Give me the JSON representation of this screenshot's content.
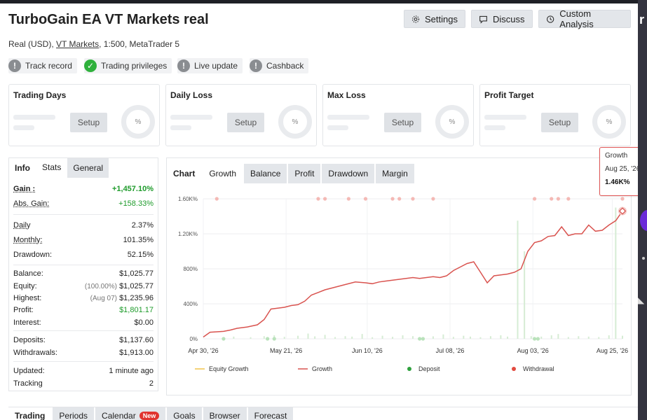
{
  "header": {
    "title": "TurboGain EA VT Markets real",
    "buttons": {
      "settings": "Settings",
      "discuss": "Discuss",
      "custom": "Custom Analysis"
    },
    "subtitle_prefix": "Real (USD), ",
    "subtitle_link": "VT Markets",
    "subtitle_suffix": ", 1:500, MetaTrader 5"
  },
  "badges": [
    {
      "label": "Track record",
      "state": "grey"
    },
    {
      "label": "Trading privileges",
      "state": "green"
    },
    {
      "label": "Live update",
      "state": "grey"
    },
    {
      "label": "Cashback",
      "state": "grey"
    }
  ],
  "kpis": [
    {
      "title": "Trading Days",
      "button": "Setup",
      "ring": "%"
    },
    {
      "title": "Daily Loss",
      "button": "Setup",
      "ring": "%"
    },
    {
      "title": "Max Loss",
      "button": "Setup",
      "ring": "%"
    },
    {
      "title": "Profit Target",
      "button": "Setup",
      "ring": "%"
    }
  ],
  "stats_tabs": [
    "Info",
    "Stats",
    "General"
  ],
  "stats": {
    "gain": {
      "label": "Gain :",
      "value": "+1,457.10%"
    },
    "abs_gain": {
      "label": "Abs. Gain:",
      "value": "+158.33%"
    },
    "daily": {
      "label": "Daily",
      "value": "2.37%"
    },
    "monthly": {
      "label": "Monthly:",
      "value": "101.35%"
    },
    "drawdown": {
      "label": "Drawdown:",
      "value": "52.15%"
    },
    "balance": {
      "label": "Balance:",
      "value": "$1,025.77"
    },
    "equity": {
      "label": "Equity:",
      "sub": "(100.00%)",
      "value": "$1,025.77"
    },
    "highest": {
      "label": "Highest:",
      "sub": "(Aug 07)",
      "value": "$1,235.96"
    },
    "profit": {
      "label": "Profit:",
      "value": "$1,801.17"
    },
    "interest": {
      "label": "Interest:",
      "value": "$0.00"
    },
    "deposits": {
      "label": "Deposits:",
      "value": "$1,137.60"
    },
    "withdrawals": {
      "label": "Withdrawals:",
      "value": "$1,913.00"
    },
    "updated": {
      "label": "Updated:",
      "value": "1 minute ago"
    },
    "tracking": {
      "label": "Tracking",
      "value": "2"
    }
  },
  "chart_tabs": [
    "Chart",
    "Growth",
    "Balance",
    "Profit",
    "Drawdown",
    "Margin"
  ],
  "tooltip": {
    "title": "Growth",
    "date": "Aug 25, '26",
    "value": "1.46K%"
  },
  "chart_data": {
    "type": "line",
    "x_tick_labels": [
      "Apr 30, '26",
      "May 21, '26",
      "Jun 10, '26",
      "Jul 08, '26",
      "Aug 03, '26",
      "Aug 25, '26"
    ],
    "y_tick_labels": [
      "0%",
      "400%",
      "800%",
      "1.20K%",
      "1.60K%"
    ],
    "ylim": [
      0,
      1600
    ],
    "grid": true,
    "legend_position": "bottom",
    "legend": [
      "Equity Growth",
      "Growth",
      "Deposit",
      "Withdrawal"
    ],
    "colors": {
      "growth": "#d9534f",
      "equity": "#f0c24b",
      "deposit": "#2fa13e",
      "withdrawal": "#e24a3f",
      "bars": "#d6ecd4"
    },
    "series": [
      {
        "name": "Growth",
        "x": [
          0,
          2,
          4,
          6,
          8,
          10,
          13,
          16,
          18,
          20,
          22,
          24,
          26,
          28,
          30,
          32,
          34,
          36,
          38,
          40,
          42,
          45,
          48,
          50,
          52,
          54,
          56,
          58,
          60,
          62,
          64,
          66,
          68,
          70,
          72,
          74,
          76,
          78,
          80,
          82,
          84,
          86,
          88,
          90,
          92,
          94,
          96,
          98,
          100,
          102,
          104,
          106,
          108,
          110,
          112,
          114,
          116,
          118,
          120,
          122,
          124
        ],
        "values": [
          20,
          75,
          80,
          85,
          100,
          120,
          135,
          160,
          220,
          340,
          350,
          360,
          380,
          390,
          430,
          500,
          530,
          560,
          580,
          600,
          620,
          650,
          640,
          630,
          650,
          660,
          670,
          680,
          690,
          700,
          690,
          700,
          710,
          700,
          720,
          780,
          820,
          860,
          880,
          760,
          640,
          720,
          730,
          740,
          760,
          800,
          1000,
          1100,
          1120,
          1170,
          1180,
          1280,
          1180,
          1200,
          1200,
          1300,
          1230,
          1240,
          1300,
          1350,
          1460
        ]
      }
    ],
    "deposit_x": [
      6,
      19,
      21,
      64,
      65,
      98,
      99
    ],
    "withdrawal_x": [
      4,
      34,
      36,
      43,
      48,
      56,
      58,
      62,
      68,
      98,
      103,
      105,
      108,
      124
    ],
    "volume_bars": [
      {
        "x": 6,
        "h": 20
      },
      {
        "x": 9,
        "h": 25
      },
      {
        "x": 14,
        "h": 18
      },
      {
        "x": 18,
        "h": 30
      },
      {
        "x": 21,
        "h": 40
      },
      {
        "x": 24,
        "h": 22
      },
      {
        "x": 28,
        "h": 35
      },
      {
        "x": 31,
        "h": 60
      },
      {
        "x": 33,
        "h": 28
      },
      {
        "x": 36,
        "h": 45
      },
      {
        "x": 39,
        "h": 20
      },
      {
        "x": 42,
        "h": 30
      },
      {
        "x": 44,
        "h": 25
      },
      {
        "x": 47,
        "h": 55
      },
      {
        "x": 50,
        "h": 18
      },
      {
        "x": 53,
        "h": 35
      },
      {
        "x": 56,
        "h": 22
      },
      {
        "x": 59,
        "h": 40
      },
      {
        "x": 62,
        "h": 30
      },
      {
        "x": 65,
        "h": 20
      },
      {
        "x": 68,
        "h": 28
      },
      {
        "x": 71,
        "h": 50
      },
      {
        "x": 74,
        "h": 22
      },
      {
        "x": 77,
        "h": 35
      },
      {
        "x": 79,
        "h": 25
      },
      {
        "x": 82,
        "h": 18
      },
      {
        "x": 85,
        "h": 30
      },
      {
        "x": 88,
        "h": 40
      },
      {
        "x": 90,
        "h": 25
      },
      {
        "x": 93,
        "h": 1350
      },
      {
        "x": 95,
        "h": 1000
      },
      {
        "x": 97,
        "h": 30
      },
      {
        "x": 100,
        "h": 25
      },
      {
        "x": 103,
        "h": 40
      },
      {
        "x": 105,
        "h": 55
      },
      {
        "x": 108,
        "h": 20
      },
      {
        "x": 111,
        "h": 30
      },
      {
        "x": 114,
        "h": 25
      },
      {
        "x": 117,
        "h": 20
      },
      {
        "x": 120,
        "h": 40
      },
      {
        "x": 122,
        "h": 1500
      },
      {
        "x": 124,
        "h": 35
      }
    ]
  },
  "bottom_tabs": [
    "Trading",
    "Periods",
    "Calendar",
    "Goals",
    "Browser",
    "Forecast"
  ],
  "new_badge": "New",
  "side": {
    "letter": "r"
  }
}
